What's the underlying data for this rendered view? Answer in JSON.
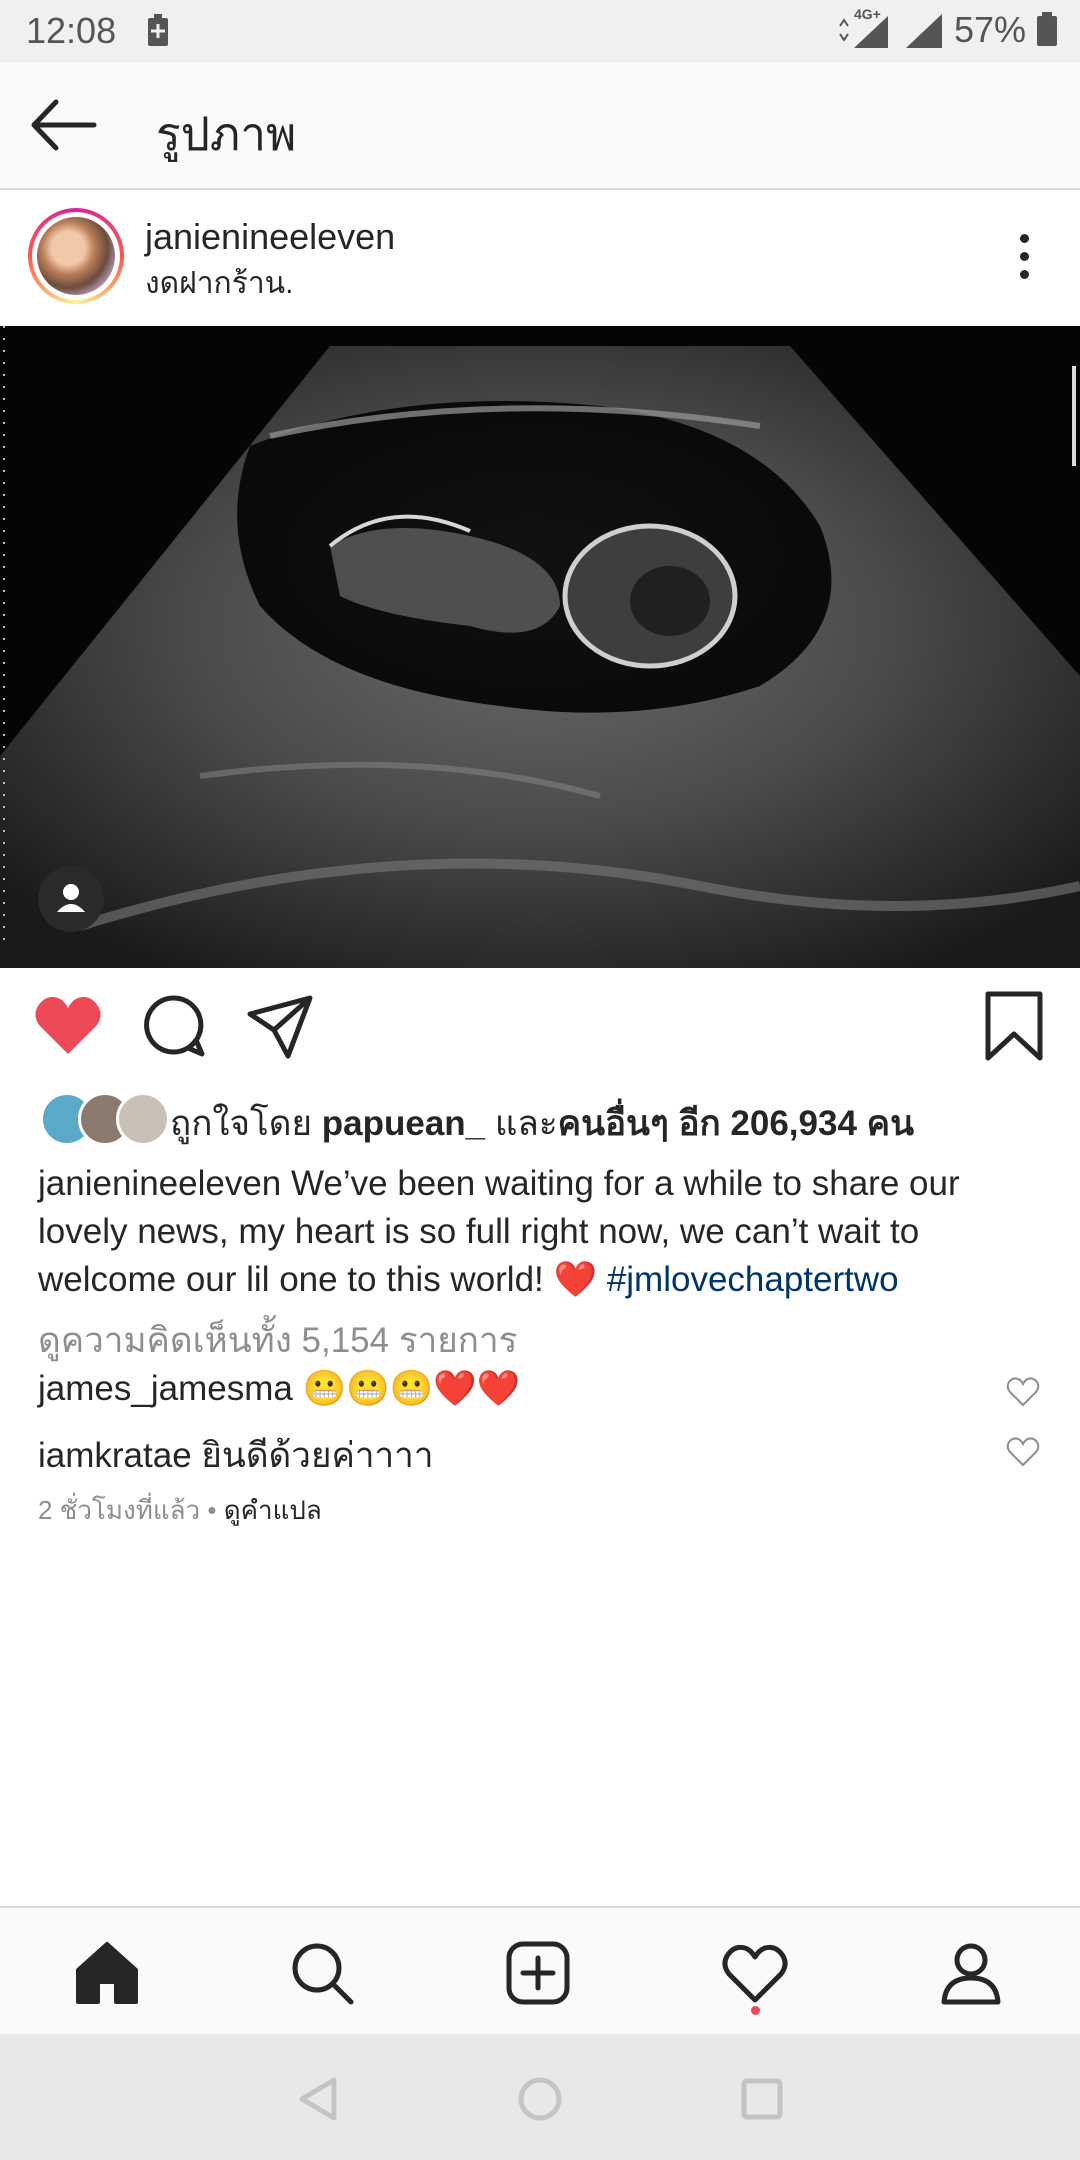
{
  "status": {
    "time": "12:08",
    "network": "4G+",
    "battery": "57%"
  },
  "header": {
    "title": "รูปภาพ"
  },
  "post": {
    "username": "janienineeleven",
    "location": "งดฝากร้าน."
  },
  "likes": {
    "prefix": "ถูกใจโดย ",
    "liker": "papuean_",
    "middle": " และ",
    "others": "คนอื่นๆ อีก 206,934 คน"
  },
  "caption": {
    "username": "janienineeleven",
    "text": " We’ve been waiting for a while to share our lovely news, my heart is so full right now, we can’t wait to welcome our lil one to this world! ❤️ ",
    "hashtag": "#jmlovechaptertwo"
  },
  "view_comments": "ดูความคิดเห็นทั้ง 5,154 รายการ",
  "comments": [
    {
      "user": "james_jamesma",
      "text": " 😬😬😬❤️❤️"
    },
    {
      "user": "iamkratae",
      "text": " ยินดีด้วยค่าาาา"
    }
  ],
  "meta": {
    "time": "2 ชั่วโมงที่แล้ว",
    "separator": " • ",
    "translate": "ดูคำแปล"
  },
  "icons": {
    "back": "arrow-left-icon",
    "more": "more-vertical-icon",
    "like": "heart-filled-icon",
    "comment": "comment-icon",
    "share": "send-icon",
    "save": "bookmark-icon",
    "home": "home-icon",
    "search": "search-icon",
    "create": "add-post-icon",
    "activity": "heart-outline-icon",
    "profile": "profile-icon"
  },
  "colors": {
    "like_red": "#ed4956",
    "hashtag_blue": "#003569",
    "text": "#262626",
    "muted": "#8e8e8e"
  }
}
